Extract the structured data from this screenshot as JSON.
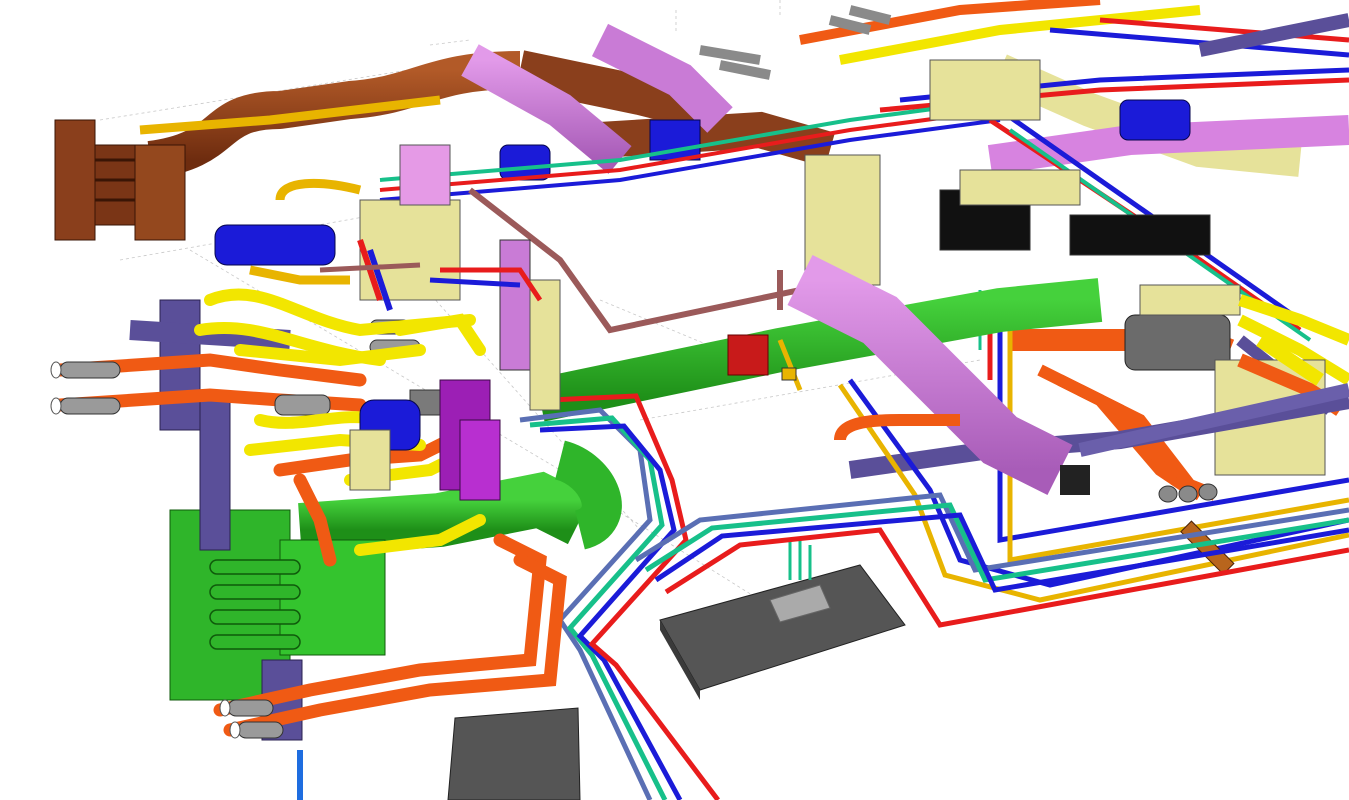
{
  "scene": {
    "kind": "3D MEP coordination model view",
    "background": "#ffffff",
    "systems": [
      {
        "name": "supply-duct",
        "color": "#c97bd6"
      },
      {
        "name": "return-duct",
        "color": "#2fb52a"
      },
      {
        "name": "exhaust-duct",
        "color": "#8a3f1c"
      },
      {
        "name": "heating-water-pipe",
        "color": "#f05a14"
      },
      {
        "name": "chilled-water-pipe",
        "color": "#f2e600"
      },
      {
        "name": "condenser-pipe",
        "color": "#e8b400"
      },
      {
        "name": "gas-pipe",
        "color": "#1b1bd8"
      },
      {
        "name": "fire-pipe",
        "color": "#e81c1c"
      },
      {
        "name": "drain-pipe",
        "color": "#9b5a5a"
      },
      {
        "name": "plumbing-pipe",
        "color": "#17c08a"
      },
      {
        "name": "cable-tray",
        "color": "#5a4f99"
      },
      {
        "name": "equipment",
        "color": "#e6e29a"
      },
      {
        "name": "slab-opening",
        "color": "#555555"
      }
    ]
  }
}
